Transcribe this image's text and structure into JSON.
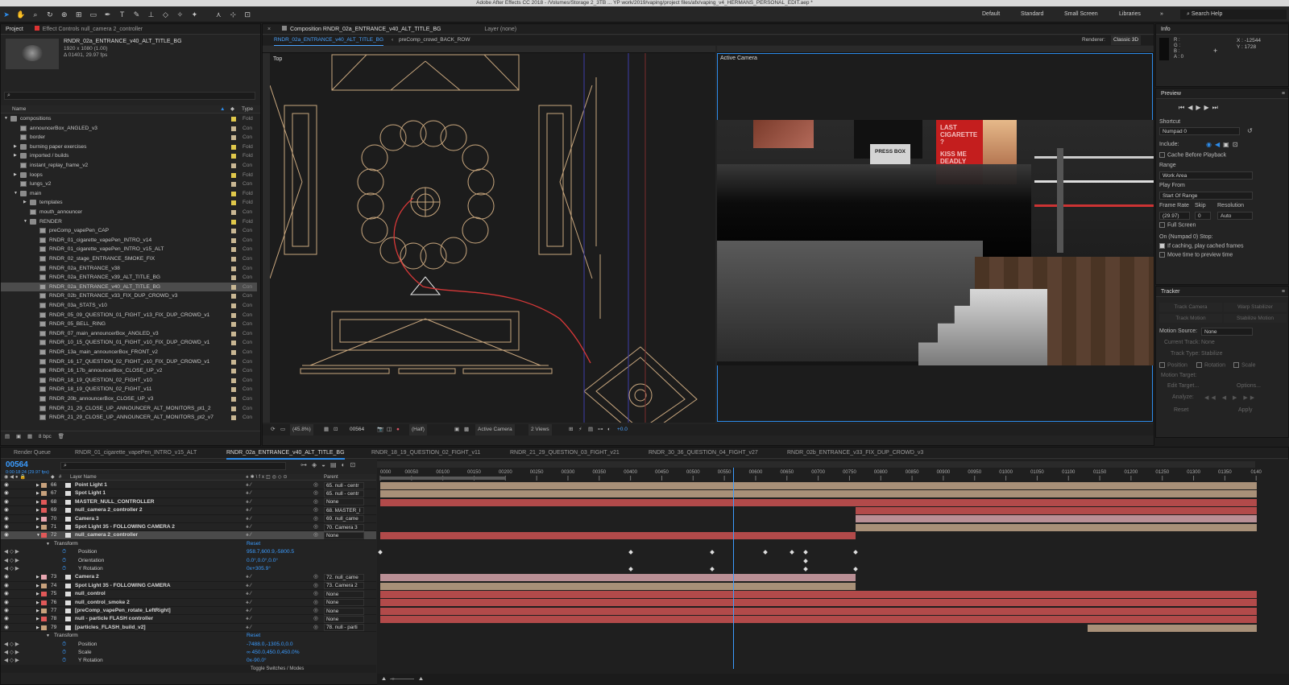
{
  "window": {
    "title": "Adobe After Effects CC 2018 - /Volumes/Storage 2_3TB ... YP work/2019/vaping/project files/afx/vaping_v4_HERMANS_PERSONAL_EDIT.aep *"
  },
  "workspaces": [
    "Default",
    "Standard",
    "Small Screen",
    "Libraries"
  ],
  "search_help": "Search Help",
  "project": {
    "tabs": [
      "Project",
      "Effect Controls null_camera 2_controller"
    ],
    "selected_name": "RNDR_02a_ENTRANCE_v40_ALT_TITLE_BG",
    "meta_1": "1920 x 1080 (1.00)",
    "meta_2": "Δ 01401, 29.97 fps",
    "col_name": "Name",
    "col_type": "Type",
    "items": [
      {
        "name": "compositions",
        "indent": 0,
        "kind": "folder",
        "open": true,
        "type": "Fold"
      },
      {
        "name": "announcerBox_ANGLED_v3",
        "indent": 1,
        "kind": "comp",
        "type": "Con"
      },
      {
        "name": "border",
        "indent": 1,
        "kind": "comp",
        "type": "Con"
      },
      {
        "name": "burning paper exercises",
        "indent": 1,
        "kind": "folder",
        "type": "Fold"
      },
      {
        "name": "imported / builds",
        "indent": 1,
        "kind": "folder",
        "type": "Fold"
      },
      {
        "name": "instant_replay_frame_v2",
        "indent": 1,
        "kind": "comp",
        "type": "Con"
      },
      {
        "name": "loops",
        "indent": 1,
        "kind": "folder",
        "type": "Fold"
      },
      {
        "name": "lungs_v2",
        "indent": 1,
        "kind": "comp",
        "type": "Con"
      },
      {
        "name": "main",
        "indent": 1,
        "kind": "folder",
        "open": true,
        "type": "Fold"
      },
      {
        "name": "templates",
        "indent": 2,
        "kind": "folder",
        "type": "Fold"
      },
      {
        "name": "mouth_announcer",
        "indent": 2,
        "kind": "comp",
        "type": "Con"
      },
      {
        "name": "RENDER",
        "indent": 2,
        "kind": "folder",
        "open": true,
        "type": "Fold"
      },
      {
        "name": "preComp_vapePen_CAP",
        "indent": 3,
        "kind": "comp",
        "type": "Con"
      },
      {
        "name": "RNDR_01_cigarette_vapePen_INTRO_v14",
        "indent": 3,
        "kind": "comp",
        "type": "Con"
      },
      {
        "name": "RNDR_01_cigarette_vapePen_INTRO_v15_ALT",
        "indent": 3,
        "kind": "comp",
        "type": "Con"
      },
      {
        "name": "RNDR_02_stage_ENTRANCE_SMOKE_FIX",
        "indent": 3,
        "kind": "comp",
        "type": "Con"
      },
      {
        "name": "RNDR_02a_ENTRANCE_v38",
        "indent": 3,
        "kind": "comp",
        "type": "Con"
      },
      {
        "name": "RNDR_02a_ENTRANCE_v39_ALT_TITLE_BG",
        "indent": 3,
        "kind": "comp",
        "type": "Con"
      },
      {
        "name": "RNDR_02a_ENTRANCE_v40_ALT_TITLE_BG",
        "indent": 3,
        "kind": "comp",
        "type": "Con",
        "selected": true
      },
      {
        "name": "RNDR_02b_ENTRANCE_v33_FIX_DUP_CROWD_v3",
        "indent": 3,
        "kind": "comp",
        "type": "Con"
      },
      {
        "name": "RNDR_03a_STATS_v10",
        "indent": 3,
        "kind": "comp",
        "type": "Con"
      },
      {
        "name": "RNDR_05_09_QUESTION_01_FIGHT_v13_FIX_DUP_CROWD_v1",
        "indent": 3,
        "kind": "comp",
        "type": "Con"
      },
      {
        "name": "RNDR_05_BELL_RING",
        "indent": 3,
        "kind": "comp",
        "type": "Con"
      },
      {
        "name": "RNDR_07_main_announcerBox_ANGLED_v3",
        "indent": 3,
        "kind": "comp",
        "type": "Con"
      },
      {
        "name": "RNDR_10_15_QUESTION_01_FIGHT_v10_FIX_DUP_CROWD_v1",
        "indent": 3,
        "kind": "comp",
        "type": "Con"
      },
      {
        "name": "RNDR_13a_main_announcerBox_FRONT_v2",
        "indent": 3,
        "kind": "comp",
        "type": "Con"
      },
      {
        "name": "RNDR_16_17_QUESTION_02_FIGHT_v10_FIX_DUP_CROWD_v1",
        "indent": 3,
        "kind": "comp",
        "type": "Con"
      },
      {
        "name": "RNDR_16_17b_announcerBox_CLOSE_UP_v2",
        "indent": 3,
        "kind": "comp",
        "type": "Con"
      },
      {
        "name": "RNDR_18_19_QUESTION_02_FIGHT_v10",
        "indent": 3,
        "kind": "comp",
        "type": "Con"
      },
      {
        "name": "RNDR_18_19_QUESTION_02_FIGHT_v11",
        "indent": 3,
        "kind": "comp",
        "type": "Con"
      },
      {
        "name": "RNDR_20b_announcerBox_CLOSE_UP_v3",
        "indent": 3,
        "kind": "comp",
        "type": "Con"
      },
      {
        "name": "RNDR_21_29_CLOSE_UP_ANNOUNCER_ALT_MONITORS_pt1_2",
        "indent": 3,
        "kind": "comp",
        "type": "Con"
      },
      {
        "name": "RNDR_21_29_CLOSE_UP_ANNOUNCER_ALT_MONITORS_pt2_v7",
        "indent": 3,
        "kind": "comp",
        "type": "Con"
      }
    ],
    "bpc": "8 bpc"
  },
  "composition": {
    "tab": "Composition RNDR_02a_ENTRANCE_v40_ALT_TITLE_BG",
    "layer_tab": "Layer (none)",
    "breadcrumb_1": "RNDR_02a_ENTRANCE_v40_ALT_TITLE_BG",
    "breadcrumb_2": "preComp_crowd_BACK_ROW",
    "renderer_label": "Renderer:",
    "renderer": "Classic 3D",
    "view_left": "Top",
    "view_right": "Active Camera",
    "zoom": "(45.8%)",
    "timecode": "00564",
    "resolution": "(Half)",
    "camera_menu": "Active Camera",
    "views_menu": "2 Views",
    "exposure": "+0.0",
    "press_box": "PRESS BOX",
    "billboard_1": "LAST CIGARETTE ?",
    "billboard_2": "KISS ME DEADLY"
  },
  "info_panel": {
    "title": "Info",
    "r": "R :",
    "g": "G :",
    "b": "B :",
    "a": "A : 0",
    "x": "X : -12544",
    "y": "Y : 1728"
  },
  "preview_panel": {
    "title": "Preview",
    "shortcut_label": "Shortcut",
    "shortcut": "Numpad 0",
    "include_label": "Include:",
    "cache": "Cache Before Playback",
    "range_label": "Range",
    "range": "Work Area",
    "playfrom_label": "Play From",
    "playfrom": "Start Of Range",
    "framerate_label": "Frame Rate",
    "skip_label": "Skip",
    "resolution_label": "Resolution",
    "framerate": "(29.97)",
    "skip": "0",
    "resolution": "Auto",
    "fullscreen": "Full Screen",
    "stop_label": "On (Numpad 0) Stop:",
    "stop_1": "If caching, play cached frames",
    "stop_2": "Move time to preview time"
  },
  "tracker_panel": {
    "title": "Tracker",
    "track_camera": "Track Camera",
    "warp_stabilizer": "Warp Stabilizer",
    "track_motion": "Track Motion",
    "stabilize_motion": "Stabilize Motion",
    "motion_source_label": "Motion Source:",
    "motion_source": "None",
    "current_track_label": "Current Track:",
    "current_track": "None",
    "track_type_label": "Track Type:",
    "track_type": "Stabilize",
    "position": "Position",
    "rotation": "Rotation",
    "scale": "Scale",
    "motion_target": "Motion Target:",
    "edit_target": "Edit Target...",
    "options": "Options...",
    "analyze": "Analyze:",
    "reset": "Reset",
    "apply": "Apply"
  },
  "timeline": {
    "tabs": [
      "Render Queue",
      "RNDR_01_cigarette_vapePen_INTRO_v15_ALT",
      "RNDR_02a_ENTRANCE_v40_ALT_TITLE_BG",
      "RNDR_18_19_QUESTION_02_FIGHT_v11",
      "RNDR_21_29_QUESTION_03_FIGHT_v21",
      "RNDR_30_36_QUESTION_04_FIGHT_v27",
      "RNDR_02b_ENTRANCE_v33_FIX_DUP_CROWD_v3"
    ],
    "current_time": "00564",
    "current_time_sub": "0:00:18:24 (29.97 fps)",
    "search_placeholder": "",
    "col_layer_name": "Layer Name",
    "col_parent": "Parent",
    "ruler_labels": [
      "0000",
      "00050",
      "00100",
      "00150",
      "00200",
      "00250",
      "00300",
      "00350",
      "00400",
      "00450",
      "00500",
      "00550",
      "00600",
      "00650",
      "00700",
      "00750",
      "00800",
      "00850",
      "00900",
      "00950",
      "01000",
      "01050",
      "01100",
      "01150",
      "01200",
      "01250",
      "01300",
      "01350",
      "0140"
    ],
    "total_frames": 1401,
    "work_area_end": 200,
    "rows": [
      {
        "kind": "layer",
        "num": "66",
        "name": "Point Light 1",
        "color": "#c7a17c",
        "parent": "65. null - centr",
        "bar": [
          0,
          1401
        ],
        "bar_color": "#a89078"
      },
      {
        "kind": "layer",
        "num": "67",
        "name": "Spot Light 1",
        "color": "#c7a17c",
        "parent": "65. null - centr",
        "bar": [
          0,
          1401
        ],
        "bar_color": "#a89078"
      },
      {
        "kind": "layer",
        "num": "68",
        "name": "MASTER_NULL_CONTROLLER",
        "color": "#e05858",
        "parent": "None",
        "bar": [
          0,
          1401
        ],
        "bar_color": "#b24a4a"
      },
      {
        "kind": "layer",
        "num": "69",
        "name": "null_camera 2_controller 2",
        "color": "#e05858",
        "parent": "68. MASTER_I",
        "bar": [
          760,
          1401
        ],
        "bar_color": "#b24a4a"
      },
      {
        "kind": "layer",
        "num": "70",
        "name": "Camera 3",
        "color": "#e8a6b0",
        "parent": "69. null_came",
        "bar": [
          760,
          1401
        ],
        "bar_color": "#b98f95"
      },
      {
        "kind": "layer",
        "num": "71",
        "name": "Spot Light 35 - FOLLOWING CAMERA 2",
        "color": "#c7a17c",
        "parent": "70. Camera 3",
        "bar": [
          760,
          1401
        ],
        "bar_color": "#a89078"
      },
      {
        "kind": "layer",
        "num": "72",
        "name": "null_camera 2_controller",
        "color": "#e05858",
        "parent": "None",
        "bar": [
          0,
          760
        ],
        "bar_color": "#b24a4a",
        "selected": true
      },
      {
        "kind": "group",
        "name": "Transform",
        "value": "Reset"
      },
      {
        "kind": "prop",
        "name": "Position",
        "value": "958.7,600.9,-5800.5",
        "keys": [
          0,
          400,
          530,
          615,
          658,
          680,
          760
        ]
      },
      {
        "kind": "prop",
        "name": "Orientation",
        "value": "0.0°,0.0°,0.0°",
        "keys": [
          680
        ]
      },
      {
        "kind": "prop",
        "name": "Y Rotation",
        "value": "0x+305.9°",
        "keys": [
          400,
          530,
          680,
          760
        ]
      },
      {
        "kind": "layer",
        "num": "73",
        "name": "Camera 2",
        "color": "#e8a6b0",
        "parent": "72. null_came",
        "bar": [
          0,
          760
        ],
        "bar_color": "#b98f95"
      },
      {
        "kind": "layer",
        "num": "74",
        "name": "Spot Light 35 - FOLLOWING CAMERA",
        "color": "#c7a17c",
        "parent": "73. Camera 2",
        "bar": [
          0,
          760
        ],
        "bar_color": "#a89078"
      },
      {
        "kind": "layer",
        "num": "75",
        "name": "null_control",
        "color": "#e05858",
        "parent": "None",
        "bar": [
          0,
          1401
        ],
        "bar_color": "#b24a4a"
      },
      {
        "kind": "layer",
        "num": "76",
        "name": "null_control_smoke 2",
        "color": "#e05858",
        "parent": "None",
        "bar": [
          0,
          1401
        ],
        "bar_color": "#b24a4a"
      },
      {
        "kind": "layer",
        "num": "77",
        "name": "[preComp_vapePen_rotate_LeftRight]",
        "color": "#c7a17c",
        "parent": "None",
        "bar": [
          0,
          1401
        ],
        "bar_color": "#b24a4a"
      },
      {
        "kind": "layer",
        "num": "78",
        "name": "null - particle FLASH controller",
        "color": "#e05858",
        "parent": "None",
        "bar": [
          0,
          1401
        ],
        "bar_color": "#b24a4a"
      },
      {
        "kind": "layer",
        "num": "79",
        "name": "[particles_FLASH_build_v2]",
        "color": "#c7a17c",
        "parent": "78. null - parti",
        "bar": [
          1130,
          1401
        ],
        "bar_color": "#a89078"
      },
      {
        "kind": "group",
        "name": "Transform",
        "value": "Reset"
      },
      {
        "kind": "prop",
        "name": "Position",
        "value": "-7488.0,-1305.0,0.0",
        "keys": []
      },
      {
        "kind": "prop",
        "name": "Scale",
        "value": "∞ 450.0,450.0,450.0%",
        "keys": []
      },
      {
        "kind": "prop",
        "name": "Y Rotation",
        "value": "0x-90.0°",
        "keys": []
      }
    ],
    "toggle": "Toggle Switches / Modes",
    "playhead_frame": 564
  }
}
